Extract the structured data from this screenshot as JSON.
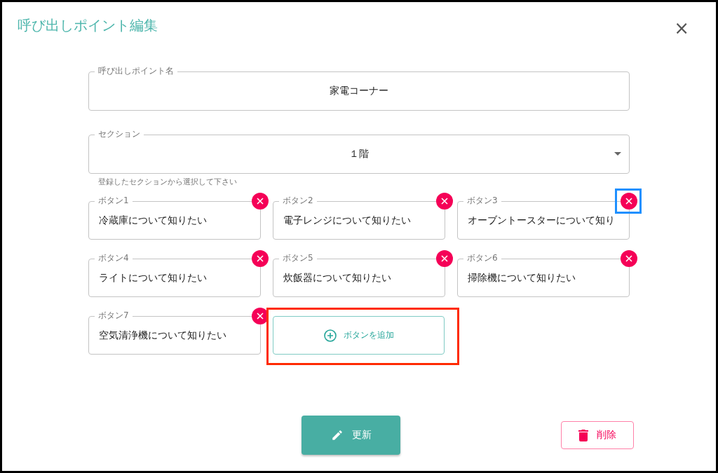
{
  "dialog": {
    "title": "呼び出しポイント編集",
    "close": "×"
  },
  "name_field": {
    "label": "呼び出しポイント名",
    "value": "家電コーナー"
  },
  "section_field": {
    "label": "セクション",
    "value": "１階",
    "helper": "登録したセクションから選択して下さい"
  },
  "buttons": [
    {
      "label": "ボタン1",
      "value": "冷蔵庫について知りたい",
      "delete_highlighted": false
    },
    {
      "label": "ボタン2",
      "value": "電子レンジについて知りたい",
      "delete_highlighted": false
    },
    {
      "label": "ボタン3",
      "value": "オーブントースターについて知り",
      "delete_highlighted": true
    },
    {
      "label": "ボタン4",
      "value": "ライトについて知りたい",
      "delete_highlighted": false
    },
    {
      "label": "ボタン5",
      "value": "炊飯器について知りたい",
      "delete_highlighted": false
    },
    {
      "label": "ボタン6",
      "value": "掃除機について知りたい",
      "delete_highlighted": false
    },
    {
      "label": "ボタン7",
      "value": "空気清浄機について知りたい",
      "delete_highlighted": false
    }
  ],
  "add_button": {
    "label": "ボタンを追加",
    "highlighted": true
  },
  "actions": {
    "update": "更新",
    "delete": "削除"
  }
}
